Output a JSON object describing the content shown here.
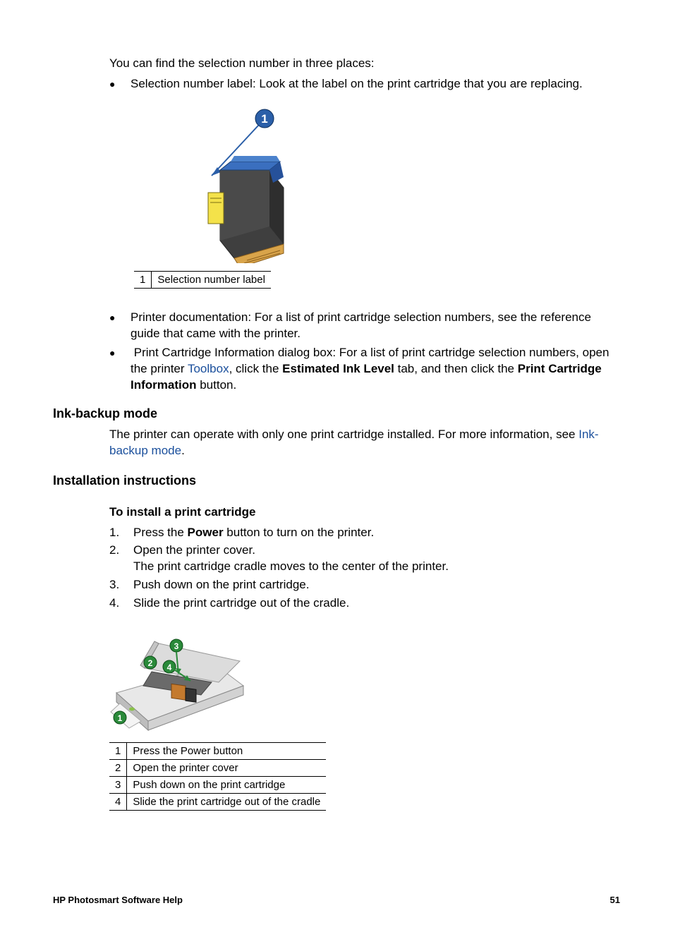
{
  "intro": "You can find the selection number in three places:",
  "bullet1": "Selection number label: Look at the label on the print cartridge that you are replacing.",
  "labelTable": {
    "num": "1",
    "text": "Selection number label"
  },
  "bullet2": "Printer documentation: For a list of print cartridge selection numbers, see the reference guide that came with the printer.",
  "bullet3": {
    "pre": "Print Cartridge Information dialog box: For a list of print cartridge selection numbers, open the printer ",
    "link": "Toolbox",
    "mid1": ", click the ",
    "bold1": "Estimated Ink Level",
    "mid2": " tab, and then click the ",
    "bold2": "Print Cartridge Information",
    "post": " button."
  },
  "section1": {
    "heading": "Ink-backup mode",
    "pre": "The printer can operate with only one print cartridge installed. For more information, see ",
    "link": "Ink-backup mode",
    "post": "."
  },
  "section2": {
    "heading": "Installation instructions",
    "subheading": "To install a print cartridge",
    "steps": [
      {
        "n": "1.",
        "pre": "Press the ",
        "bold": "Power",
        "post": " button to turn on the printer."
      },
      {
        "n": "2.",
        "pre": "Open the printer cover.",
        "bold": "",
        "post": "",
        "extra": "The print cartridge cradle moves to the center of the printer."
      },
      {
        "n": "3.",
        "pre": "Push down on the print cartridge.",
        "bold": "",
        "post": ""
      },
      {
        "n": "4.",
        "pre": "Slide the print cartridge out of the cradle.",
        "bold": "",
        "post": ""
      }
    ]
  },
  "table2": [
    {
      "n": "1",
      "text": "Press the Power button"
    },
    {
      "n": "2",
      "text": "Open the printer cover"
    },
    {
      "n": "3",
      "text": "Push down on the print cartridge"
    },
    {
      "n": "4",
      "text": "Slide the print cartridge out of the cradle"
    }
  ],
  "footer": {
    "left": "HP Photosmart Software Help",
    "right": "51"
  }
}
